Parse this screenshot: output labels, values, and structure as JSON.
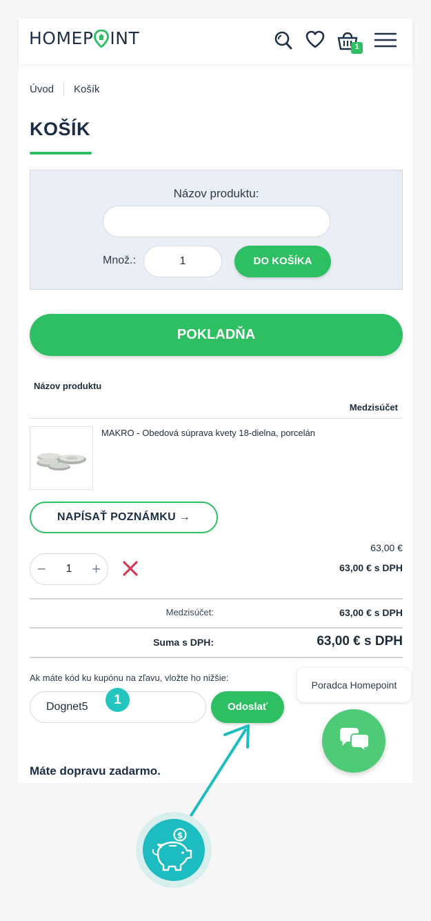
{
  "header": {
    "logo_prefix": "HOMEP",
    "logo_suffix": "INT",
    "cart_count": "1",
    "colors": {
      "brand_green": "#2dbf62",
      "navy": "#1f2f45"
    }
  },
  "breadcrumb": {
    "home": "Úvod",
    "current": "Košík"
  },
  "page": {
    "title": "KOŠÍK"
  },
  "quick_add": {
    "label": "Názov produktu:",
    "name_value": "",
    "qty_label": "Množ.:",
    "qty_value": "1",
    "add_button": "DO KOŠÍKA"
  },
  "checkout_button": "POKLADŇA",
  "cart_table": {
    "col_product": "Názov produktu",
    "col_subtotal": "Medzisúčet",
    "item": {
      "name": "MAKRO - Obedová súprava kvety 18-dielna, porcelán",
      "note_button": "NAPÍSAŤ POZNÁMKU →",
      "unit_price": "63,00 €",
      "line_total": "63,00 € s DPH",
      "quantity": "1"
    }
  },
  "totals": {
    "subtotal_label": "Medzisúčet:",
    "subtotal_value": "63,00 € s DPH",
    "total_label": "Suma s DPH:",
    "total_value": "63,00 € s DPH"
  },
  "coupon": {
    "prompt": "Ak máte kód ku kupónu na zľavu, vložte ho nižšie:",
    "value": "Dognet5",
    "send_button": "Odoslať"
  },
  "shipping_note": "Máte dopravu zadarmo.",
  "chat": {
    "advisor_label": "Poradca Homepoint"
  },
  "annotation": {
    "step_number": "1",
    "accent_color": "#1dbcc0"
  }
}
